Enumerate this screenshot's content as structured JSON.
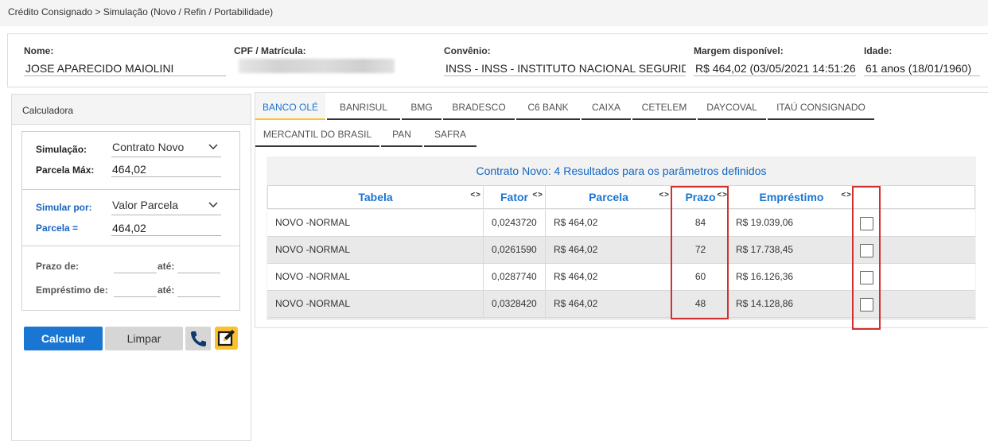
{
  "breadcrumb": "Crédito Consignado > Simulação (Novo / Refin / Portabilidade)",
  "client": {
    "nome_label": "Nome:",
    "nome_value": "JOSE APARECIDO MAIOLINI",
    "cpf_label": "CPF / Matrícula:",
    "convenio_label": "Convênio:",
    "convenio_value": "INSS - INSS - INSTITUTO NACIONAL SEGURIDADE",
    "margem_label": "Margem disponível:",
    "margem_value": "R$ 464,02 (03/05/2021 14:51:26)",
    "idade_label": "Idade:",
    "idade_value": "61 anos (18/01/1960)"
  },
  "calculator": {
    "title": "Calculadora",
    "simulacao_label": "Simulação:",
    "simulacao_value": "Contrato Novo",
    "parcela_max_label": "Parcela Máx:",
    "parcela_max_value": "464,02",
    "simular_por_label": "Simular por:",
    "simular_por_value": "Valor Parcela",
    "parcela_label": "Parcela =",
    "parcela_value": "464,02",
    "prazo_de_label": "Prazo de:",
    "prazo_ate_label": "até:",
    "emprestimo_de_label": "Empréstimo de:",
    "emprestimo_ate_label": "até:",
    "calcular_label": "Calcular",
    "limpar_label": "Limpar"
  },
  "tabs": [
    "BANCO OLÉ",
    "BANRISUL",
    "BMG",
    "BRADESCO",
    "C6 BANK",
    "CAIXA",
    "CETELEM",
    "DAYCOVAL",
    "ITAÚ CONSIGNADO",
    "MERCANTIL DO BRASIL",
    "PAN",
    "SAFRA"
  ],
  "active_tab": "BANCO OLÉ",
  "results": {
    "title": "Contrato Novo: 4 Resultados para os parâmetros definidos",
    "columns": [
      "Tabela",
      "Fator",
      "Parcela",
      "Prazo",
      "Empréstimo"
    ],
    "sort_glyph": "<>",
    "rows": [
      {
        "tabela": "NOVO -NORMAL",
        "fator": "0,0243720",
        "parcela": "R$ 464,02",
        "prazo": "84",
        "emprestimo": "R$ 19.039,06"
      },
      {
        "tabela": "NOVO -NORMAL",
        "fator": "0,0261590",
        "parcela": "R$ 464,02",
        "prazo": "72",
        "emprestimo": "R$ 17.738,45"
      },
      {
        "tabela": "NOVO -NORMAL",
        "fator": "0,0287740",
        "parcela": "R$ 464,02",
        "prazo": "60",
        "emprestimo": "R$ 16.126,36"
      },
      {
        "tabela": "NOVO -NORMAL",
        "fator": "0,0328420",
        "parcela": "R$ 464,02",
        "prazo": "48",
        "emprestimo": "R$ 14.128,86"
      }
    ]
  },
  "colors": {
    "accent_blue": "#1976d2",
    "active_tab_underline": "#fbc02d",
    "highlight_red": "#d32f2f",
    "edit_button": "#fbc02d"
  },
  "icons": {
    "phone": "phone-icon",
    "edit": "edit-icon",
    "chevron": "chevron-down-icon"
  }
}
